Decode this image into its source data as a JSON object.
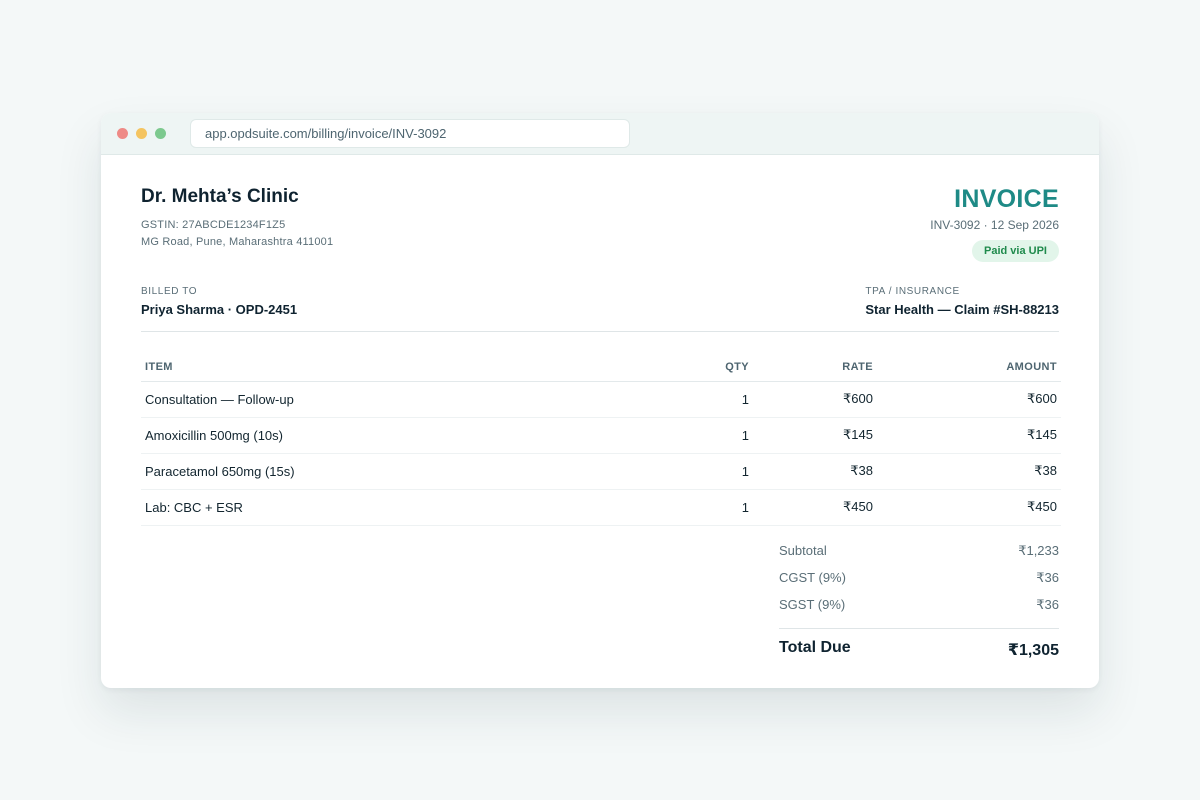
{
  "browser": {
    "url": "app.opdsuite.com/billing/invoice/INV-3092"
  },
  "clinic": {
    "name": "Dr. Mehta’s Clinic",
    "gstin": "GSTIN: 27ABCDE1234F1Z5",
    "address": "MG Road, Pune, Maharashtra 411001"
  },
  "invoice": {
    "title": "INVOICE",
    "meta": "INV-3092 · 12 Sep 2026",
    "status": "Paid via UPI"
  },
  "billed_to": {
    "label": "BILLED TO",
    "value": "Priya Sharma · OPD-2451"
  },
  "insurance": {
    "label": "TPA / INSURANCE",
    "value": "Star Health — Claim #SH-88213"
  },
  "table": {
    "headers": {
      "item": "ITEM",
      "qty": "QTY",
      "rate": "RATE",
      "amount": "AMOUNT"
    },
    "rows": [
      {
        "item": "Consultation — Follow-up",
        "qty": "1",
        "rate": "₹600",
        "amount": "₹600"
      },
      {
        "item": "Amoxicillin 500mg (10s)",
        "qty": "1",
        "rate": "₹145",
        "amount": "₹145"
      },
      {
        "item": "Paracetamol 650mg (15s)",
        "qty": "1",
        "rate": "₹38",
        "amount": "₹38"
      },
      {
        "item": "Lab: CBC + ESR",
        "qty": "1",
        "rate": "₹450",
        "amount": "₹450"
      }
    ]
  },
  "totals": {
    "subtotal_label": "Subtotal",
    "subtotal": "₹1,233",
    "cgst_label": "CGST (9%)",
    "cgst": "₹36",
    "sgst_label": "SGST (9%)",
    "sgst": "₹36",
    "total_label": "Total Due",
    "total": "₹1,305"
  },
  "colors": {
    "accent": "#1e8a86",
    "paid_badge_bg": "#e2f5ea",
    "paid_badge_text": "#1f8a4c"
  }
}
